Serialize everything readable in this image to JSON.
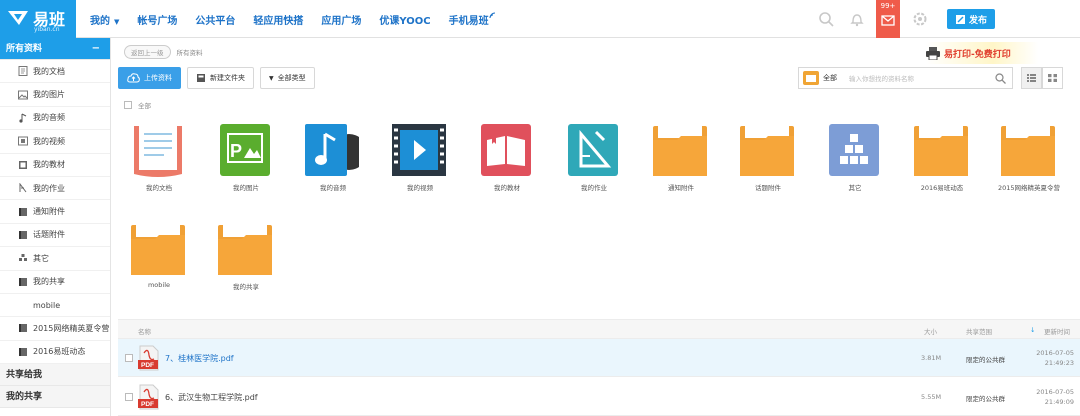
{
  "logo": {
    "text": "易班",
    "sub": "yiban.cn"
  },
  "nav": {
    "items": [
      {
        "label": "我的",
        "caret": "▼"
      },
      {
        "label": "帐号广场"
      },
      {
        "label": "公共平台"
      },
      {
        "label": "轻应用快搭"
      },
      {
        "label": "应用广场"
      },
      {
        "label": "优课YOOC"
      },
      {
        "label": "手机易班"
      }
    ]
  },
  "topbar": {
    "mail_badge": "99+",
    "publish_label": "发布"
  },
  "sidebar": {
    "all_label": "所有资料",
    "collapse": "−",
    "items": [
      {
        "label": "我的文档"
      },
      {
        "label": "我的图片"
      },
      {
        "label": "我的音频"
      },
      {
        "label": "我的视频"
      },
      {
        "label": "我的教材"
      },
      {
        "label": "我的作业"
      },
      {
        "label": "通知附件"
      },
      {
        "label": "话题附件"
      },
      {
        "label": "其它"
      },
      {
        "label": "我的共享"
      },
      {
        "label": "mobile"
      },
      {
        "label": "2015网络精英夏令营"
      },
      {
        "label": "2016易班动态"
      }
    ],
    "shared_to_me": "共享给我",
    "my_share": "我的共享"
  },
  "breadcrumb": {
    "back": "返回上一级",
    "current": "所有资料"
  },
  "print_ad": {
    "text": "易打印-免费打印"
  },
  "toolbar": {
    "upload": "上传资料",
    "new_folder": "新建文件夹",
    "type_filter": "全部类型"
  },
  "search": {
    "scope": "全部",
    "placeholder": "输入你想找的资料名称"
  },
  "select_all": "全部",
  "grid": {
    "tiles": [
      {
        "label": "我的文档",
        "kind": "doc"
      },
      {
        "label": "我的图片",
        "kind": "pic"
      },
      {
        "label": "我的音频",
        "kind": "audio"
      },
      {
        "label": "我的视频",
        "kind": "video"
      },
      {
        "label": "我的教材",
        "kind": "book"
      },
      {
        "label": "我的作业",
        "kind": "homework"
      },
      {
        "label": "通知附件",
        "kind": "folder"
      },
      {
        "label": "话题附件",
        "kind": "folder"
      },
      {
        "label": "其它",
        "kind": "other"
      },
      {
        "label": "2016易班动态",
        "kind": "folder"
      },
      {
        "label": "2015网络精英夏令营",
        "kind": "folder"
      },
      {
        "label": "mobile",
        "kind": "folder"
      },
      {
        "label": "我的共享",
        "kind": "folder"
      }
    ]
  },
  "list": {
    "headers": {
      "name": "名称",
      "size": "大小",
      "share": "共享范围",
      "date": "更新时间"
    },
    "rows": [
      {
        "name": "7、桂林医学院.pdf",
        "size": "3.81M",
        "share": "限定的公共群",
        "date": "2016-07-05",
        "time": "21:49:23",
        "badge": "PDF"
      },
      {
        "name": "6、武汉生物工程学院.pdf",
        "size": "5.55M",
        "share": "限定的公共群",
        "date": "2016-07-05",
        "time": "21:49:09",
        "badge": "PDF"
      }
    ]
  },
  "colors": {
    "accent": "#1e9ee8",
    "folder": "#f6a63a",
    "pdf": "#d83b30"
  }
}
